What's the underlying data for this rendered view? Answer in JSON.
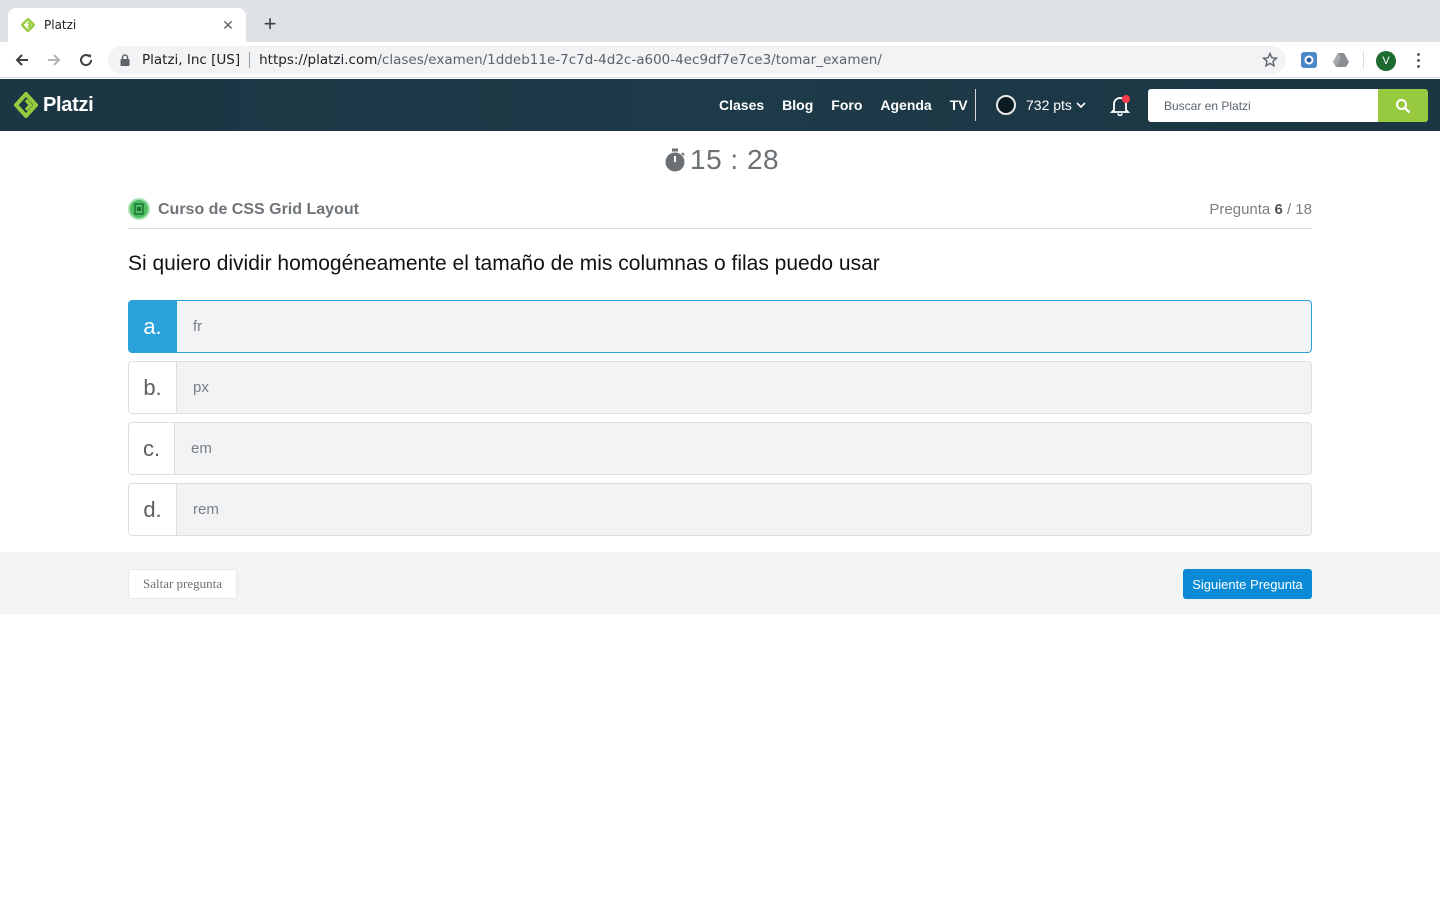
{
  "browser": {
    "tab_title": "Platzi",
    "site_identity": "Platzi, Inc [US]",
    "url_host": "https://platzi.com",
    "url_path": "/clases/examen/1ddeb11e-7c7d-4d2c-a600-4ec9df7e7ce3/tomar_examen/",
    "profile_initial": "V"
  },
  "header": {
    "logo_text": "Platzi",
    "nav": [
      "Clases",
      "Blog",
      "Foro",
      "Agenda",
      "TV"
    ],
    "points": "732 pts",
    "search_placeholder": "Buscar en Platzi",
    "accent_color": "#98ca3f"
  },
  "exam": {
    "timer": "15 : 28",
    "course": "Curso de CSS Grid Layout",
    "question_label": "Pregunta",
    "question_current": "6",
    "question_total": "/ 18",
    "question_text": "Si quiero dividir homogéneamente el tamaño de mis columnas o filas puedo usar",
    "options": [
      {
        "letter": "a.",
        "text": "fr",
        "selected": true
      },
      {
        "letter": "b.",
        "text": "px",
        "selected": false
      },
      {
        "letter": "c.",
        "text": "em",
        "selected": false
      },
      {
        "letter": "d.",
        "text": "rem",
        "selected": false
      }
    ],
    "skip_label": "Saltar pregunta",
    "next_label": "Siguiente Pregunta",
    "selected_color": "#2ba1d9"
  }
}
